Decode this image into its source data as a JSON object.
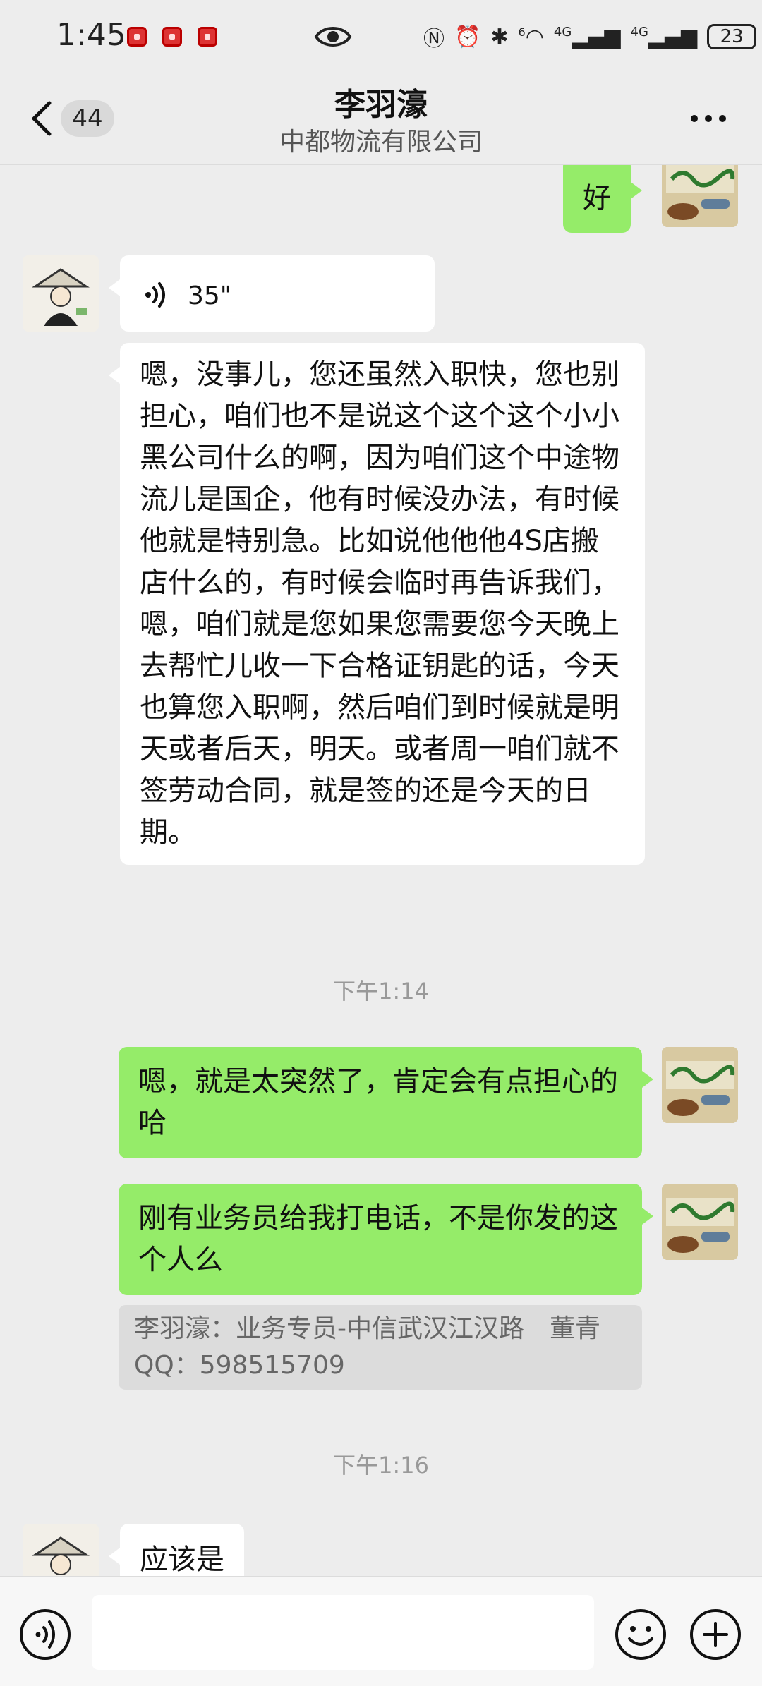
{
  "status_bar": {
    "time": "1:45",
    "network_labels": [
      "6",
      "4G",
      "4G"
    ],
    "battery": "23"
  },
  "header": {
    "unread_count": "44",
    "title": "李羽濠",
    "subtitle": "中都物流有限公司"
  },
  "messages": {
    "m0_text": "好",
    "voice_length": "35\"",
    "m2_text": "嗯，没事儿，您还虽然入职快，您也别担心，咱们也不是说这个这个这个小小黑公司什么的啊，因为咱们这个中途物流儿是国企，他有时候没办法，有时候他就是特别急。比如说他他他4S店搬店什么的，有时候会临时再告诉我们，嗯，咱们就是您如果您需要您今天晚上去帮忙儿收一下合格证钥匙的话，今天也算您入职啊，然后咱们到时候就是明天或者后天，明天。或者周一咱们就不签劳动合同，就是签的还是今天的日期。",
    "time1": "下午1:14",
    "m3_text": "嗯，就是太突然了，肯定会有点担心的哈",
    "m4_text": "刚有业务员给我打电话，不是你发的这个人么",
    "quote_text": "李羽濠：业务专员-中信武汉江汉路　董青QQ：598515709",
    "time2": "下午1:16",
    "m5_text": "应该是"
  },
  "colors": {
    "background": "#ededed",
    "outgoing_bubble": "#95ec69",
    "incoming_bubble": "#ffffff"
  },
  "icons": [
    "back-icon",
    "more-icon",
    "voice-icon",
    "emoji-icon",
    "plus-icon"
  ]
}
